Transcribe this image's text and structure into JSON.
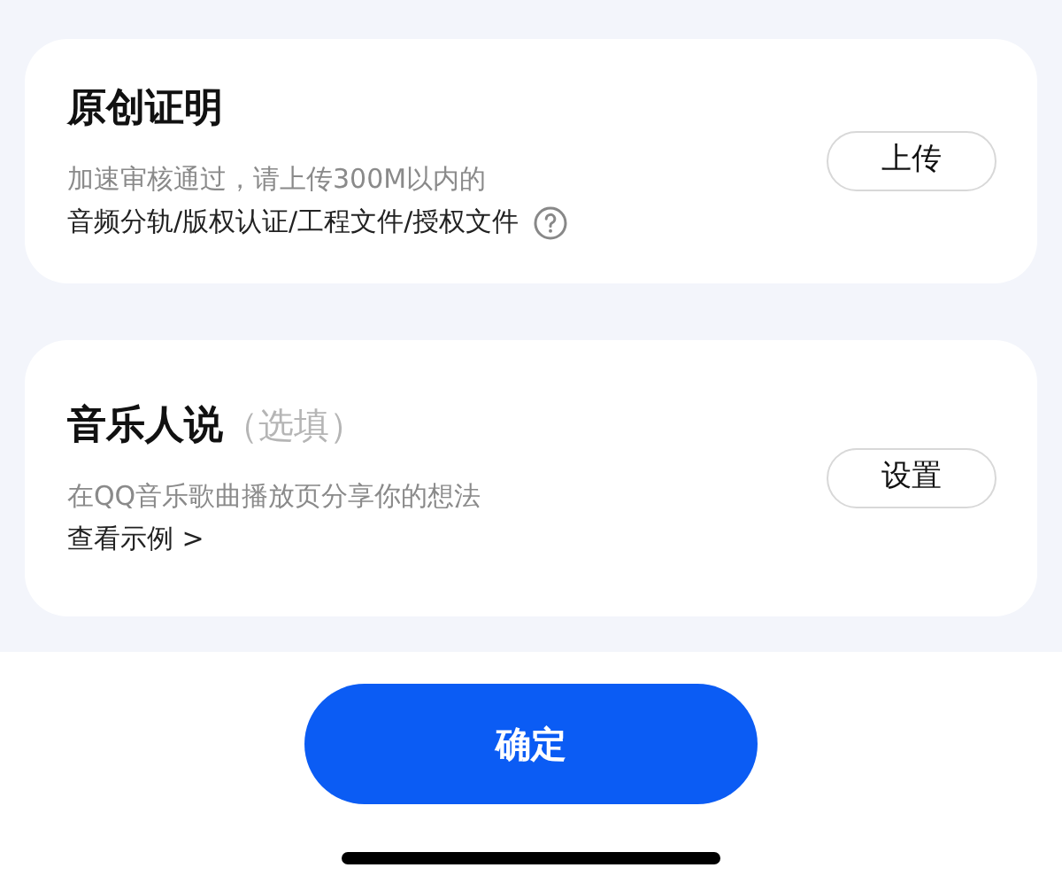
{
  "cards": [
    {
      "title": "原创证明",
      "lines": [
        {
          "text": "加速审核通过，请上传300M以内的",
          "kind": "hint"
        },
        {
          "text": "音频分轨/版权认证/工程文件/授权文件",
          "kind": "help"
        }
      ],
      "button": "上传"
    },
    {
      "title": "音乐人说",
      "title_note": "（选填）",
      "lines": [
        {
          "text": "在QQ音乐歌曲播放页分享你的想法",
          "kind": "hint"
        },
        {
          "text": "查看示例 >",
          "kind": "link"
        }
      ],
      "button": "设置"
    }
  ],
  "confirm_button": "确定"
}
